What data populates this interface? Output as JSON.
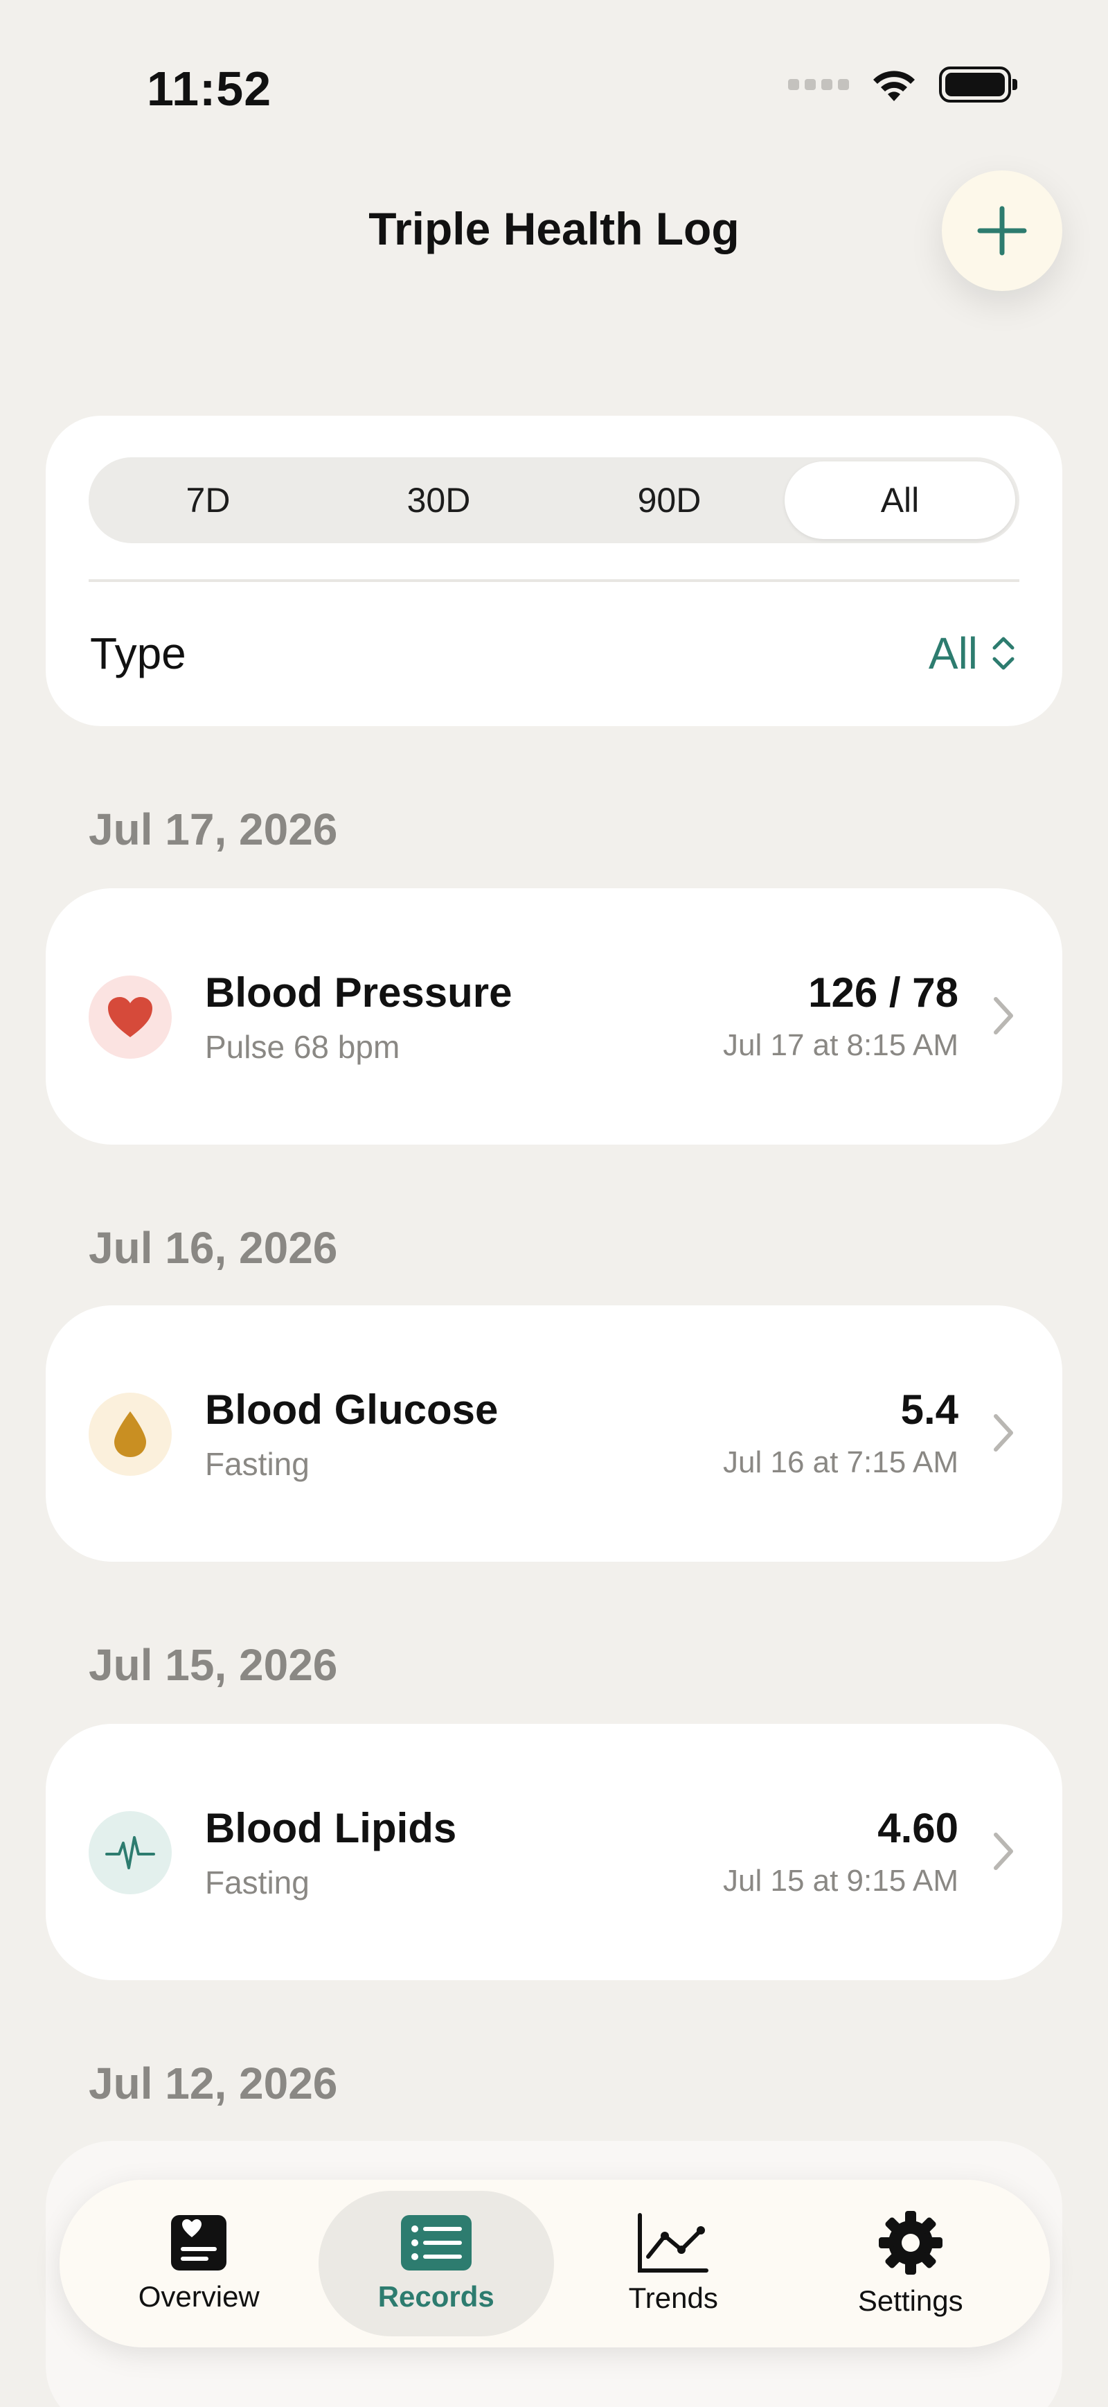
{
  "status_bar": {
    "time": "11:52"
  },
  "header": {
    "title": "Triple Health Log"
  },
  "filter": {
    "ranges": [
      {
        "label": "7D",
        "active": false
      },
      {
        "label": "30D",
        "active": false
      },
      {
        "label": "90D",
        "active": false
      },
      {
        "label": "All",
        "active": true
      }
    ],
    "type_label": "Type",
    "type_value": "All"
  },
  "sections": [
    {
      "date": "Jul 17, 2026",
      "record": {
        "name": "Blood Pressure",
        "sub": "Pulse 68 bpm",
        "value": "126 / 78",
        "time": "Jul 17 at 8:15 AM",
        "icon": "heart-icon",
        "icon_bg": "#fbe3e1",
        "icon_color": "#d64a3a"
      }
    },
    {
      "date": "Jul 16, 2026",
      "record": {
        "name": "Blood Glucose",
        "sub": "Fasting",
        "value": "5.4",
        "time": "Jul 16 at 7:15 AM",
        "icon": "drop-icon",
        "icon_bg": "#fbf0dc",
        "icon_color": "#c98f22"
      }
    },
    {
      "date": "Jul 15, 2026",
      "record": {
        "name": "Blood Lipids",
        "sub": "Fasting",
        "value": "4.60",
        "time": "Jul 15 at 9:15 AM",
        "icon": "pulse-icon",
        "icon_bg": "#e3f0ed",
        "icon_color": "#2d7c6f"
      }
    },
    {
      "date": "Jul 12, 2026"
    }
  ],
  "tab_bar": {
    "tabs": [
      {
        "label": "Overview",
        "icon": "overview-icon",
        "active": false
      },
      {
        "label": "Records",
        "icon": "records-icon",
        "active": true
      },
      {
        "label": "Trends",
        "icon": "trends-icon",
        "active": false
      },
      {
        "label": "Settings",
        "icon": "gear-icon",
        "active": false
      }
    ]
  },
  "colors": {
    "accent": "#2d7c6f",
    "background": "#f2f0ec",
    "muted_text": "#8a8884"
  }
}
